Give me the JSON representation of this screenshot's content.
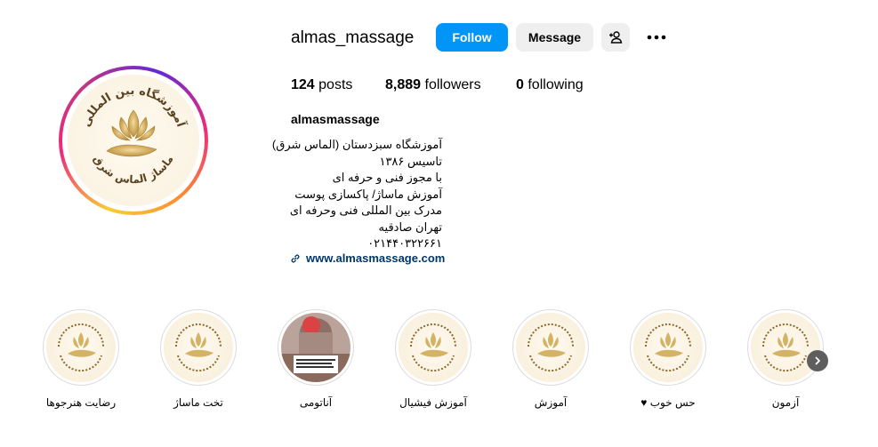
{
  "profile": {
    "username": "almas_massage",
    "follow_label": "Follow",
    "message_label": "Message",
    "add_user_icon": "person-add-icon",
    "more_icon": "more-horizontal-icon",
    "avatar_text": {
      "top": "آموزشگاه بین المللی",
      "bottom": "ماساژ الماس شرق"
    }
  },
  "stats": {
    "posts_count": "124",
    "posts_label": "posts",
    "followers_count": "8,889",
    "followers_label": "followers",
    "following_count": "0",
    "following_label": "following"
  },
  "bio": {
    "full_name": "almasmassage",
    "lines": [
      "آموزشگاه سبزدستان (الماس شرق)",
      "تاسیس ۱۳۸۶",
      "با مجوز فنی و حرفه ای",
      "آموزش ماساژ/ پاکسازی پوست",
      "مدرک بین المللی فنی وحرفه ای",
      "تهران صادقیه",
      "۰۲۱۴۴۰۳۲۲۶۶۱"
    ],
    "website": "www.almasmassage.com"
  },
  "highlights": [
    {
      "label": "رضایت هنرجوها",
      "type": "logo"
    },
    {
      "label": "تخت ماساژ",
      "type": "logo"
    },
    {
      "label": "آناتومی",
      "type": "photo"
    },
    {
      "label": "آموزش فیشیال",
      "type": "logo"
    },
    {
      "label": "آموزش",
      "type": "logo"
    },
    {
      "label": "حس خوب ♥",
      "type": "logo"
    },
    {
      "label": "آزمون",
      "type": "logo"
    }
  ],
  "colors": {
    "follow_bg": "#0095f6",
    "secondary_bg": "#efefef",
    "link": "#00376b",
    "gold": "#c9a44f"
  }
}
